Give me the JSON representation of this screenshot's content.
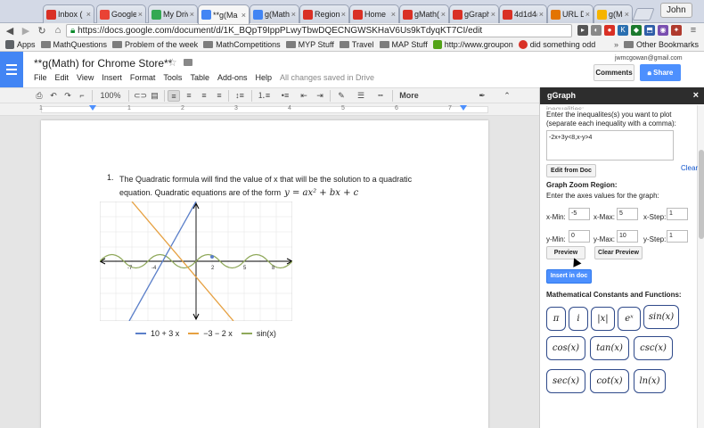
{
  "browser": {
    "tabs": [
      {
        "title": "Inbox (",
        "color": "#d93025"
      },
      {
        "title": "Google",
        "color": "#e94235"
      },
      {
        "title": "My Driv",
        "color": "#34a853"
      },
      {
        "title": "**g(Ma",
        "color": "#4285f4"
      },
      {
        "title": "g(Math",
        "color": "#4285f4"
      },
      {
        "title": "Region",
        "color": "#d93025"
      },
      {
        "title": "Home",
        "color": "#d93025"
      },
      {
        "title": "gMath(",
        "color": "#d93025"
      },
      {
        "title": "gGraph",
        "color": "#d93025"
      },
      {
        "title": "4d1d4(",
        "color": "#d93025"
      },
      {
        "title": "URL De",
        "color": "#e37400"
      },
      {
        "title": "g(Math",
        "color": "#f6b400"
      }
    ],
    "user": "John",
    "url": "https://docs.google.com/document/d/1K_BQpT9IppPLwyTbwDQECNGWSKHaV6Us9kTdyqKT7CI/edit",
    "bookmarks": [
      {
        "label": "Apps",
        "kind": "apps"
      },
      {
        "label": "MathQuestions",
        "kind": "folder"
      },
      {
        "label": "Problem of the week",
        "kind": "folder"
      },
      {
        "label": "MathCompetitions",
        "kind": "folder"
      },
      {
        "label": "MYP Stuff",
        "kind": "folder"
      },
      {
        "label": "Travel",
        "kind": "folder"
      },
      {
        "label": "MAP Stuff",
        "kind": "folder"
      },
      {
        "label": "http://www.groupon",
        "kind": "site"
      },
      {
        "label": "did something odd",
        "kind": "site"
      }
    ],
    "other_bookmarks": "Other Bookmarks"
  },
  "doc": {
    "title": "**g(Math) for Chrome Store**",
    "menu": [
      "File",
      "Edit",
      "View",
      "Insert",
      "Format",
      "Tools",
      "Table",
      "Add-ons",
      "Help"
    ],
    "saved_status": "All changes saved in Drive",
    "account": "jwmcgowan@gmail.com",
    "comments_label": "Comments",
    "share_label": "Share",
    "zoom": "100%",
    "more_label": "More",
    "ruler_numbers": [
      "1",
      "1",
      "2",
      "3",
      "4",
      "5",
      "6",
      "7"
    ],
    "question_number": "1.",
    "question_text": "The Quadratic formula will find the value of x that will be the solution to a quadratic equation. Quadratic equations are of the form",
    "formula": "y = ax² + bx + c",
    "graph_ticks": [
      "-7",
      "-4",
      "2",
      "5",
      "8"
    ],
    "legend": [
      {
        "label": "10 + 3 x",
        "color": "#5b7fc9"
      },
      {
        "label": "−3 − 2 x",
        "color": "#e6a040"
      },
      {
        "label": "sin(x)",
        "color": "#8fa85a"
      }
    ]
  },
  "panel": {
    "title": "gGraph",
    "cut_text": "inequalities:",
    "ineq_instruction": "Enter the inequalites(s) you want to plot (separate each inequality with a comma):",
    "ineq_value": "-2x+3y<8,x-y>4",
    "edit_from_doc": "Edit from Doc",
    "clear": "Clear",
    "zoom_heading": "Graph Zoom Region:",
    "zoom_instruction": "Enter the axes values for the graph:",
    "xmin_label": "x-Min:",
    "xmin": "-5",
    "xmax_label": "x-Max:",
    "xmax": "5",
    "xstep_label": "x-Step:",
    "xstep": "1",
    "ymin_label": "y-Min:",
    "ymin": "0",
    "ymax_label": "y-Max:",
    "ymax": "10",
    "ystep_label": "y-Step:",
    "ystep": "1",
    "preview": "Preview",
    "clear_preview": "Clear Preview",
    "insert": "Insert in doc",
    "math_heading": "Mathematical Constants and Functions:",
    "math_buttons": [
      "π",
      "i",
      "|x|",
      "eˣ",
      "sin(x)",
      "cos(x)",
      "tan(x)",
      "csc(x)",
      "sec(x)",
      "cot(x)",
      "ln(x)"
    ]
  }
}
